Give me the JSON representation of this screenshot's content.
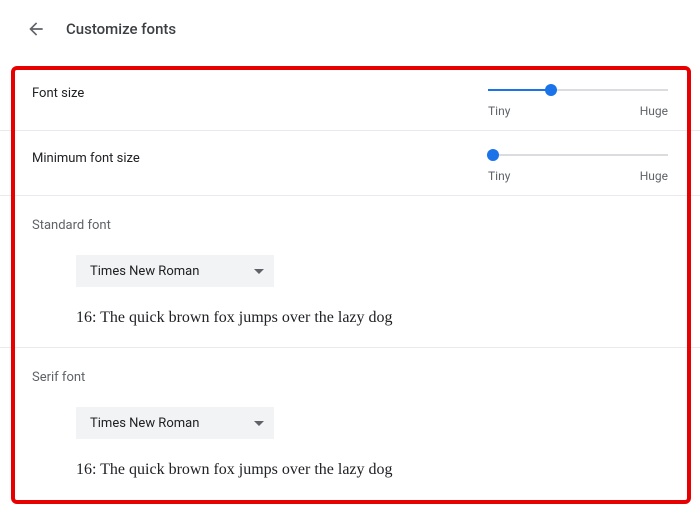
{
  "header": {
    "title": "Customize fonts"
  },
  "fontSize": {
    "label": "Font size",
    "min_label": "Tiny",
    "max_label": "Huge",
    "percent": 35
  },
  "minFontSize": {
    "label": "Minimum font size",
    "min_label": "Tiny",
    "max_label": "Huge",
    "percent": 3
  },
  "standardFont": {
    "title": "Standard font",
    "selected": "Times New Roman",
    "preview": "16: The quick brown fox jumps over the lazy dog"
  },
  "serifFont": {
    "title": "Serif font",
    "selected": "Times New Roman",
    "preview": "16: The quick brown fox jumps over the lazy dog"
  }
}
